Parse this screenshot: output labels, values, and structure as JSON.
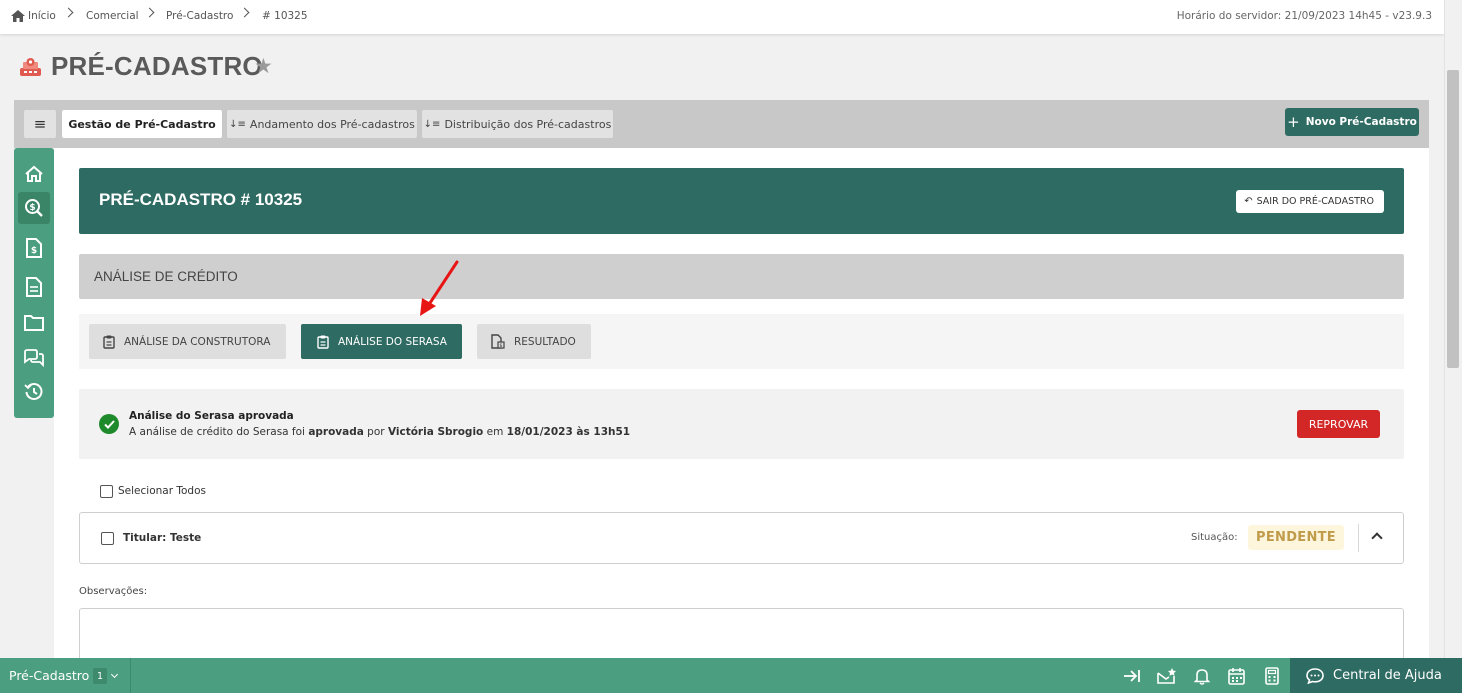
{
  "breadcrumb": {
    "items": [
      "Início",
      "Comercial",
      "Pré-Cadastro",
      "# 10325"
    ]
  },
  "server_time": "Horário do servidor: 21/09/2023 14h45 - v23.9.3",
  "page_title": "PRÉ-CADASTRO",
  "tabs": [
    {
      "label": "Gestão de Pré-Cadastro",
      "active": true
    },
    {
      "label": "Andamento dos Pré-cadastros",
      "active": false
    },
    {
      "label": "Distribuição dos Pré-cadastros",
      "active": false
    }
  ],
  "menu_icon": "≡",
  "new_button": "Novo Pré-Cadastro",
  "header": {
    "title": "PRÉ-CADASTRO # 10325",
    "exit_button": "SAIR DO PRÉ-CADASTRO"
  },
  "section_title": "ANÁLISE DE CRÉDITO",
  "subtabs": [
    {
      "label": "ANÁLISE DA CONSTRUTORA",
      "active": false
    },
    {
      "label": "ANÁLISE DO SERASA",
      "active": true
    },
    {
      "label": "RESULTADO",
      "active": false
    }
  ],
  "alert": {
    "title": "Análise do Serasa aprovada",
    "text_part1": "A análise de crédito do Serasa foi ",
    "text_bold1": "aprovada",
    "text_part2": " por ",
    "text_bold2": "Victória Sbrogio",
    "text_part3": " em ",
    "text_bold3": "18/01/2023 às 13h51",
    "reject_button": "REPROVAR"
  },
  "select_all_label": "Selecionar Todos",
  "titular": {
    "label": "Titular: Teste",
    "status_label": "Situação:",
    "status_value": "PENDENTE"
  },
  "observations_label": "Observações:",
  "bottom_bar": {
    "label": "Pré-Cadastro",
    "count": "1",
    "help_label": "Central de Ajuda"
  },
  "sidebar_icons": [
    "home-icon",
    "search-dollar-icon",
    "invoice-dollar-icon",
    "document-icon",
    "folder-icon",
    "comments-icon",
    "history-icon"
  ],
  "colors": {
    "primary": "#2e6b62",
    "sidebar": "#4c9e80",
    "danger": "#d32626",
    "success": "#1f8a2c",
    "pending_text": "#c09b4a",
    "pending_bg": "#fdf5dc"
  }
}
